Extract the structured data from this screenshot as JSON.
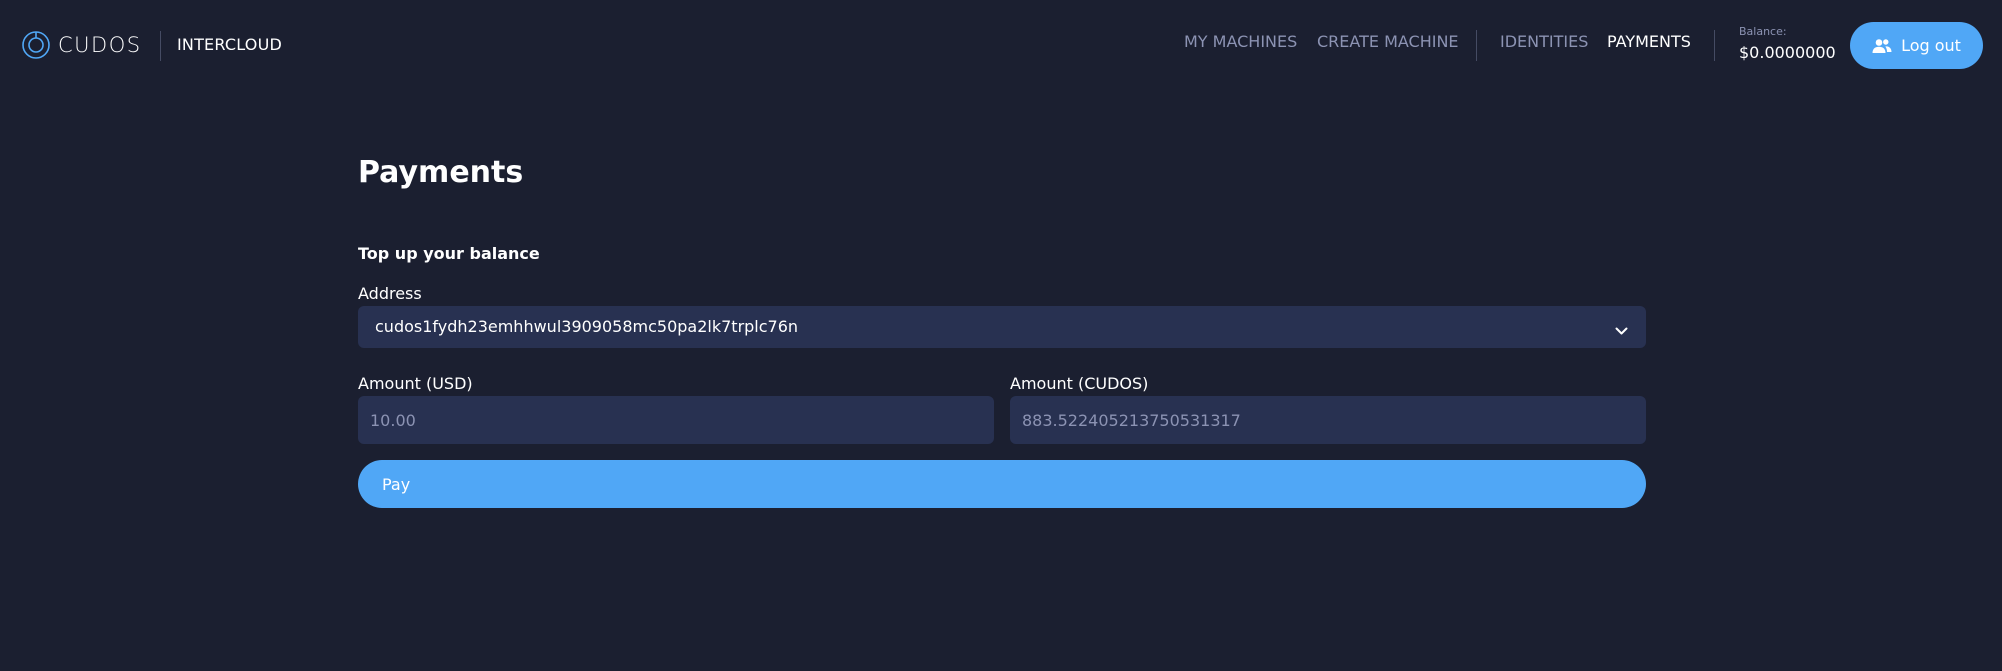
{
  "header": {
    "logo_text": "CUDOS",
    "product_name": "INTERCLOUD",
    "nav": [
      {
        "label": "MY MACHINES",
        "active": false
      },
      {
        "label": "CREATE MACHINE",
        "active": false
      },
      {
        "label": "IDENTITIES",
        "active": false
      },
      {
        "label": "PAYMENTS",
        "active": true
      }
    ],
    "balance_label": "Balance:",
    "balance_value": "$0.0000000",
    "logout_label": "Log out",
    "logout_icon": "users-icon"
  },
  "main": {
    "title": "Payments",
    "section_title": "Top up your balance",
    "address": {
      "label": "Address",
      "selected": "cudos1fydh23emhhwul3909058mc50pa2lk7trplc76n"
    },
    "amount_usd": {
      "label": "Amount (USD)",
      "placeholder": "10.00"
    },
    "amount_cudos": {
      "label": "Amount (CUDOS)",
      "placeholder": "883.522405213750531317"
    },
    "pay_label": "Pay"
  },
  "colors": {
    "background": "#1b1f30",
    "input_background": "#283151",
    "accent": "#50a7f6",
    "nav_inactive": "#8c93b3",
    "text": "#ffffff"
  }
}
